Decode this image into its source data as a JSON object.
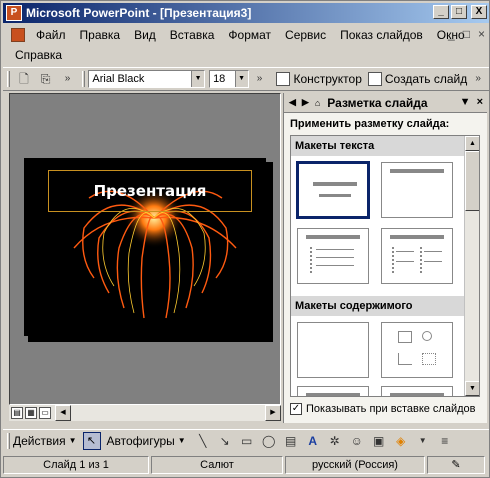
{
  "window": {
    "title": "Microsoft PowerPoint - [Презентация3]",
    "title_buttons": [
      "_",
      "□",
      "X"
    ]
  },
  "menubar": {
    "items": [
      "Файл",
      "Правка",
      "Вид",
      "Вставка",
      "Формат",
      "Сервис",
      "Показ слайдов",
      "Окно",
      "Справка"
    ],
    "mdi_buttons": [
      "_",
      "□",
      "×"
    ]
  },
  "toolbar": {
    "font_name": "Arial Black",
    "font_size": "18",
    "designer_label": "Конструктор",
    "new_slide_label": "Создать слайд"
  },
  "slide": {
    "title": "Презентация"
  },
  "taskpane": {
    "title": "Разметка слайда",
    "subtitle": "Применить разметку слайда:",
    "group_text": "Макеты текста",
    "group_content": "Макеты содержимого",
    "checkbox_label": "Показывать при вставке слайдов",
    "checkbox_checked": true
  },
  "drawbar": {
    "actions_label": "Действия",
    "autoshapes_label": "Автофигуры"
  },
  "statusbar": {
    "slide_info": "Слайд 1 из 1",
    "design": "Салют",
    "language": "русский (Россия)"
  }
}
